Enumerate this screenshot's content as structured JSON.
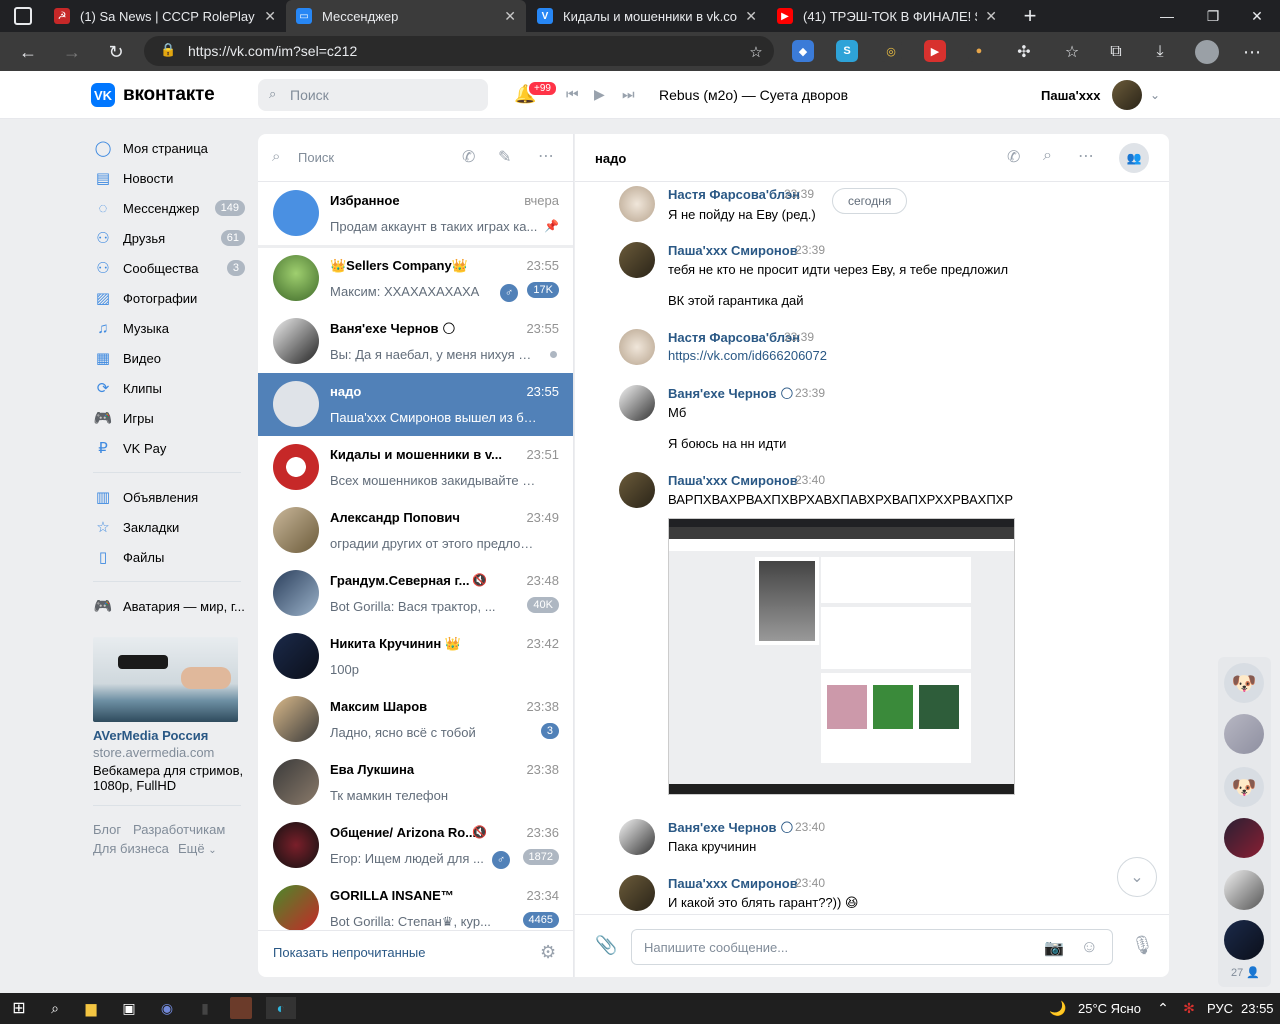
{
  "browser": {
    "tabs": [
      {
        "title": "(1) Sa News | СССР RolePlay",
        "icon": "ussr-flag-icon",
        "color": "#c62828"
      },
      {
        "title": "Мессенджер",
        "icon": "vk-messenger-icon",
        "color": "#2787f5"
      },
      {
        "title": "Кидалы и мошенники в vk.com",
        "icon": "vk-icon",
        "color": "#2787f5"
      },
      {
        "title": "(41) ТРЭШ-ТОК В ФИНАЛЕ! $1M",
        "icon": "youtube-icon",
        "color": "#ff0000"
      }
    ],
    "url": "https://vk.com/im?sel=c212"
  },
  "vk_header": {
    "logo_text": "вконтакте",
    "search_placeholder": "Поиск",
    "notifications_badge": "+99",
    "track": "Rebus (м2о) — Суета дворов",
    "user_name": "Паша'xxx"
  },
  "left_menu": {
    "items": [
      {
        "label": "Моя страница",
        "icon": "user-icon",
        "badge": ""
      },
      {
        "label": "Новости",
        "icon": "news-icon",
        "badge": ""
      },
      {
        "label": "Мессенджер",
        "icon": "message-icon",
        "badge": "149"
      },
      {
        "label": "Друзья",
        "icon": "friends-icon",
        "badge": "61"
      },
      {
        "label": "Сообщества",
        "icon": "communities-icon",
        "badge": "3"
      },
      {
        "label": "Фотографии",
        "icon": "photo-icon",
        "badge": ""
      },
      {
        "label": "Музыка",
        "icon": "music-icon",
        "badge": ""
      },
      {
        "label": "Видео",
        "icon": "video-icon",
        "badge": ""
      },
      {
        "label": "Клипы",
        "icon": "clips-icon",
        "badge": ""
      },
      {
        "label": "Игры",
        "icon": "games-icon",
        "badge": ""
      },
      {
        "label": "VK Pay",
        "icon": "vkpay-icon",
        "badge": ""
      }
    ],
    "items2": [
      {
        "label": "Объявления",
        "icon": "ads-icon"
      },
      {
        "label": "Закладки",
        "icon": "bookmark-icon"
      },
      {
        "label": "Файлы",
        "icon": "files-icon"
      }
    ],
    "app_item": "Аватария — мир, г...",
    "ad": {
      "title": "AVerMedia Россия",
      "domain": "store.avermedia.com",
      "text1": "Вебкамера для стримов,",
      "text2": "1080p, FullHD"
    },
    "footer": {
      "blog": "Блог",
      "dev": "Разработчикам",
      "biz": "Для бизнеса",
      "more": "Ещё"
    }
  },
  "dialogs": {
    "search_placeholder": "Поиск",
    "items": [
      {
        "name": "Избранное",
        "time": "вчера",
        "msg": "Продам аккаунт в таких играх ка...",
        "badge": "",
        "selected": false
      },
      {
        "name": "👑Sellers Company👑",
        "time": "23:55",
        "msg": "Максим: ХХАХАХАХАХА",
        "badge": "17K",
        "selected": false
      },
      {
        "name": "Ваня'exe Чернов 🌕",
        "time": "23:55",
        "msg": "Вы: Да я наебал, у меня нихуя не...",
        "badge": "",
        "selected": false
      },
      {
        "name": "надо",
        "time": "23:55",
        "msg": "Паша'xxx Смиронов вышел из бесе...",
        "badge": "",
        "selected": true
      },
      {
        "name": "Кидалы и мошенники в v...",
        "time": "23:51",
        "msg": "Всех мошенников закидывайте в п...",
        "badge": "",
        "selected": false
      },
      {
        "name": "Александр Попович",
        "time": "23:49",
        "msg": "оградии других от этого предложи но...",
        "badge": "",
        "selected": false
      },
      {
        "name": "Грандум.Северная г...",
        "time": "23:48",
        "msg": "Bot Gorilla: Вася трактор, ...",
        "badge": "40K",
        "selected": false
      },
      {
        "name": "Никита Кручинин 👑",
        "time": "23:42",
        "msg": "100р",
        "badge": "",
        "selected": false
      },
      {
        "name": "Максим Шаров",
        "time": "23:38",
        "msg": "Ладно, ясно всё с тобой",
        "badge": "3",
        "selected": false
      },
      {
        "name": "Ева Лукшина",
        "time": "23:38",
        "msg": "Тк мамкин телефон",
        "badge": "",
        "selected": false
      },
      {
        "name": "Общение/ Arizona Ro...",
        "time": "23:36",
        "msg": "Егор: Ищем людей для ...",
        "badge": "1872",
        "selected": false
      },
      {
        "name": "GORILLA INSANE™",
        "time": "23:34",
        "msg": "Bot Gorilla: Степан♛, кур...",
        "badge": "4465",
        "selected": false
      }
    ],
    "show_unread": "Показать непрочитанные"
  },
  "chat": {
    "title": "надо",
    "date_chip": "сегодня",
    "messages": [
      {
        "author": "Настя Фарсова'блэн",
        "time": "23:39",
        "lines": [
          "Я не пойду на Еву (ред.)"
        ]
      },
      {
        "author": "Паша'xxx Смиронов",
        "time": "23:39",
        "lines": [
          "тебя не кто не просит идти через Еву, я тебе предложил",
          "ВК этой гарантика дай"
        ]
      },
      {
        "author": "Настя Фарсова'блэн",
        "time": "23:39",
        "lines": [
          "https://vk.com/id666206072"
        ]
      },
      {
        "author": "Ваня'exe Чернов 🌕",
        "time": "23:39",
        "lines": [
          "Мб",
          "Я боюсь на нн идти"
        ]
      },
      {
        "author": "Паша'xxx Смиронов",
        "time": "23:40",
        "lines": [
          "ВАРПХВАХРВАХПХВРХАВХПАВХРХВАПХРХХРВАХПХР"
        ]
      },
      {
        "author": "Ваня'exe Чернов 🌕",
        "time": "23:40",
        "lines": [
          "Пака кручинин"
        ]
      },
      {
        "author": "Паша'xxx Смиронов",
        "time": "23:40",
        "lines": [
          "И какой это блять гарант??)) 😆"
        ]
      }
    ],
    "input_placeholder": "Напишите сообщение..."
  },
  "right_strip": {
    "count": "27"
  },
  "taskbar": {
    "weather": "25°C Ясно",
    "lang": "РУС",
    "clock": "23:55"
  }
}
